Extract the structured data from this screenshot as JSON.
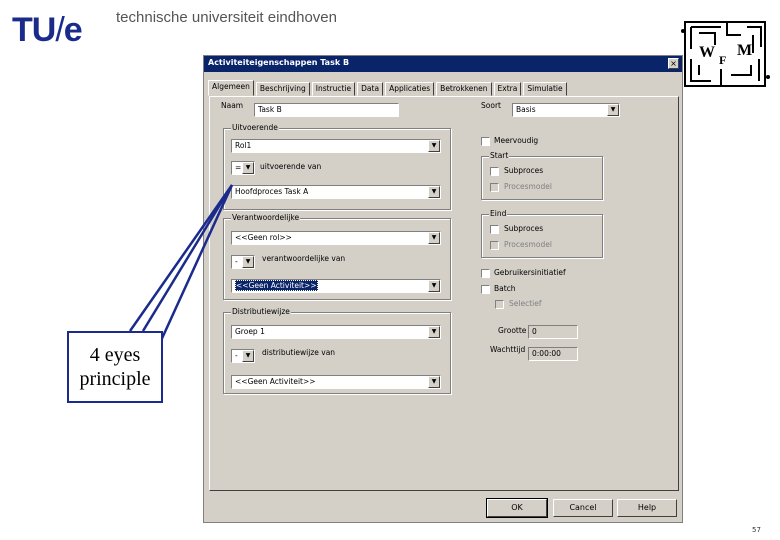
{
  "slide": {
    "logo_tu": "TU",
    "logo_slash": "/",
    "logo_e": "e",
    "university": "technische universiteit eindhoven",
    "wfm_logo": [
      "W",
      "F",
      "M"
    ],
    "callout": "4 eyes principle",
    "page_number": "57"
  },
  "dialog": {
    "title": "Activiteiteigenschappen Task B",
    "close": "×",
    "tabs": [
      "Algemeen",
      "Beschrijving",
      "Instructie",
      "Data",
      "Applicaties",
      "Betrokkenen",
      "Extra",
      "Simulatie"
    ],
    "naam": {
      "label": "Naam",
      "value": "Task B"
    },
    "soort": {
      "label": "Soort",
      "value": "Basis"
    },
    "uitvoerende": {
      "legend": "Uitvoerende",
      "role": "Rol1",
      "op": "=",
      "op_label": "uitvoerende van",
      "activity": "Hoofdproces Task A"
    },
    "verantwoordelijke": {
      "legend": "Verantwoordelijke",
      "value": "<<Geen rol>>",
      "op": "-",
      "op_label": "verantwoordelijke van",
      "activity": "<<Geen Activiteit>>"
    },
    "distributie": {
      "legend": "Distributiewijze",
      "value": "Groep 1",
      "op": "-",
      "op_label": "distributiewijze van",
      "activity": "<<Geen Activiteit>>"
    },
    "meervoudig": "Meervoudig",
    "start": {
      "legend": "Start",
      "subproces": "Subproces",
      "procesmodel": "Procesmodel"
    },
    "eind": {
      "legend": "Eind",
      "subproces": "Subproces",
      "procesmodel": "Procesmodel"
    },
    "gebruikersinitiatief": "Gebruikersinitiatief",
    "batch": "Batch",
    "selectief": "Selectief",
    "grootte": {
      "label": "Grootte",
      "value": "0"
    },
    "wachttijd": {
      "label": "Wachttijd",
      "value": "0:00:00"
    },
    "buttons": {
      "ok": "OK",
      "cancel": "Cancel",
      "help": "Help"
    }
  }
}
